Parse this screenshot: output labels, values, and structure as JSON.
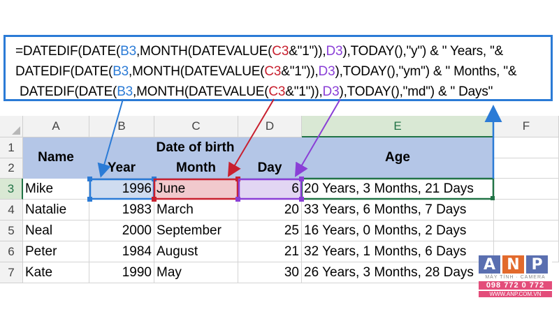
{
  "formula": {
    "line1": [
      {
        "t": "=DATEDIF(DATE(",
        "c": ""
      },
      {
        "t": "B3",
        "c": "ref-b"
      },
      {
        "t": ",MONTH(DATEVALUE(",
        "c": ""
      },
      {
        "t": "C3",
        "c": "ref-c"
      },
      {
        "t": "&\"1\"))",
        "c": ""
      },
      {
        "t": ",",
        "c": ""
      },
      {
        "t": "D3",
        "c": "ref-d"
      },
      {
        "t": "),TODAY(),\"y\") & \" Years, \"&",
        "c": ""
      }
    ],
    "line2": [
      {
        "t": "DATEDIF(DATE(",
        "c": ""
      },
      {
        "t": "B3",
        "c": "ref-b"
      },
      {
        "t": ",MONTH(DATEVALUE(",
        "c": ""
      },
      {
        "t": "C3",
        "c": "ref-c"
      },
      {
        "t": "&\"1\")),",
        "c": ""
      },
      {
        "t": "D3",
        "c": "ref-d"
      },
      {
        "t": "),TODAY(),\"ym\") & \" Months, \"&",
        "c": ""
      }
    ],
    "line3": [
      {
        "t": "DATEDIF(DATE(",
        "c": ""
      },
      {
        "t": "B3",
        "c": "ref-b"
      },
      {
        "t": ",MONTH(DATEVALUE(",
        "c": ""
      },
      {
        "t": "C3",
        "c": "ref-c"
      },
      {
        "t": "&\"1\")),",
        "c": ""
      },
      {
        "t": "D3",
        "c": "ref-d"
      },
      {
        "t": "),TODAY(),\"md\") & \" Days\"",
        "c": ""
      }
    ]
  },
  "columns": [
    "A",
    "B",
    "C",
    "D",
    "E",
    "F"
  ],
  "rows": [
    "1",
    "2",
    "3",
    "4",
    "5",
    "6",
    "7"
  ],
  "header": {
    "name": "Name",
    "date_of_birth": "Date of birth",
    "year": "Year",
    "month": "Month",
    "day": "Day",
    "age": "Age"
  },
  "data_rows": [
    {
      "name": "Mike",
      "year": "1996",
      "month": "June",
      "day": "6",
      "age": "20 Years, 3 Months, 21 Days"
    },
    {
      "name": "Natalie",
      "year": "1983",
      "month": "March",
      "day": "20",
      "age": "33 Years, 6 Months, 7 Days"
    },
    {
      "name": "Neal",
      "year": "2000",
      "month": "September",
      "day": "25",
      "age": "16 Years, 0 Months, 2 Days"
    },
    {
      "name": "Peter",
      "year": "1984",
      "month": "August",
      "day": "21",
      "age": "32 Years, 1 Months, 6 Days"
    },
    {
      "name": "Kate",
      "year": "1990",
      "month": "May",
      "day": "30",
      "age": "26 Years, 3 Months, 28 Days"
    }
  ],
  "logo": {
    "letters": [
      "A",
      "N",
      "P"
    ],
    "tagline": "MÁY TÍNH · CAMERA",
    "phone": "098 772 0 772",
    "website": "WWW.ANP.COM.VN"
  },
  "colors": {
    "ref_b": "#2b7bd6",
    "ref_c": "#c8202f",
    "ref_d": "#8a3fd6",
    "header_fill": "#b4c6e7",
    "active_green": "#217346"
  }
}
